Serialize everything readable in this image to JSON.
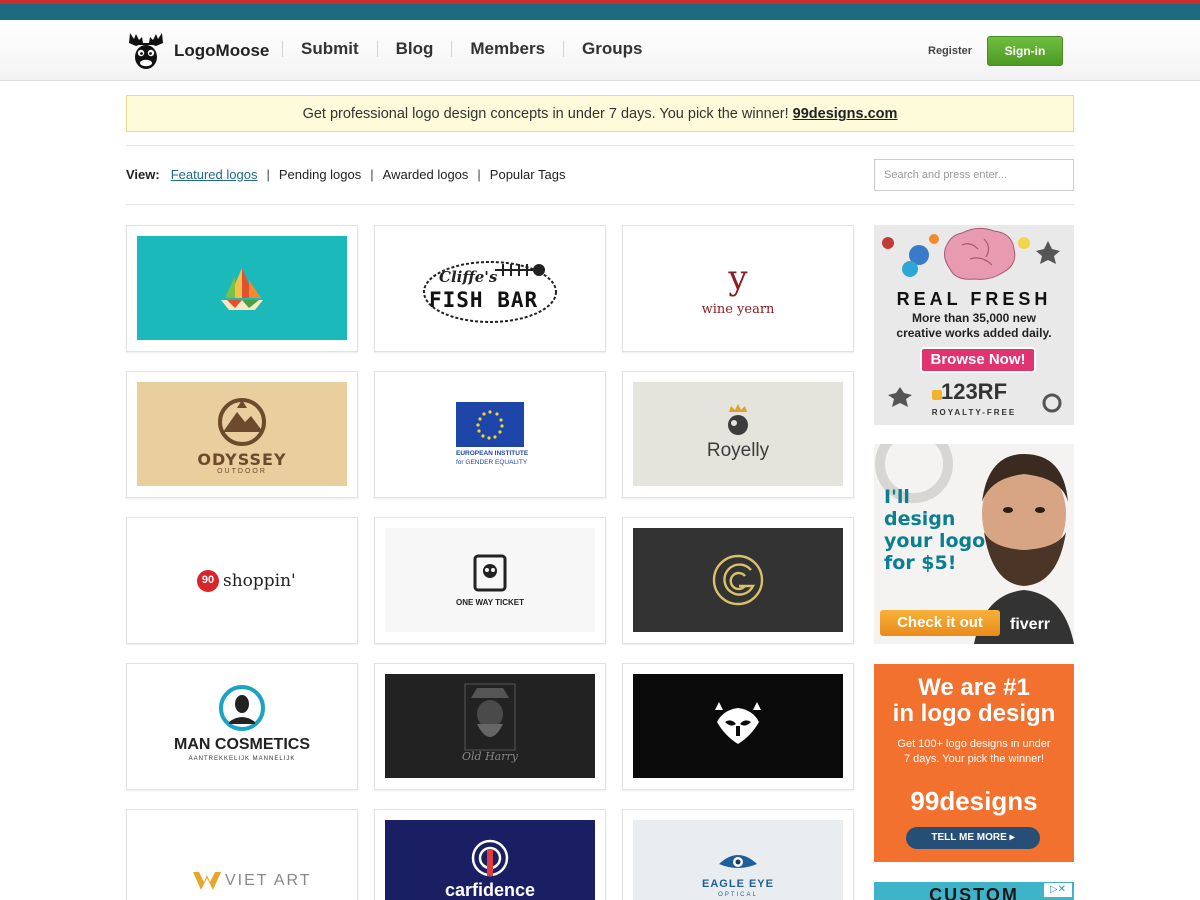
{
  "site": {
    "name": "LogoMoose"
  },
  "nav": {
    "items": [
      "Submit",
      "Blog",
      "Members",
      "Groups"
    ],
    "register": "Register",
    "signin": "Sign-in"
  },
  "promo": {
    "text": "Get professional logo design concepts in under 7 days. You pick the winner!",
    "link": "99designs.com"
  },
  "view": {
    "label": "View:",
    "links": [
      "Featured logos",
      "Pending logos",
      "Awarded logos",
      "Popular Tags"
    ],
    "active": 0
  },
  "search": {
    "placeholder": "Search and press enter..."
  },
  "logos": {
    "cliffes": {
      "line1": "Cliffe's",
      "line2": "FISH BAR"
    },
    "wine": {
      "mark": "y",
      "name": "wine yearn"
    },
    "odyssey": {
      "name": "ODYSSEY",
      "sub": "OUTDOOR"
    },
    "european": {
      "line1": "EUROPEAN INSTITUTE",
      "line2": "for GENDER EQUALITY"
    },
    "royelly": {
      "name": "Royelly"
    },
    "shoppin": {
      "badge": "90",
      "name": "shoppin'"
    },
    "oneway": {
      "name": "ONE WAY TICKET"
    },
    "man": {
      "name": "MAN COSMETICS",
      "sub": "AANTREKKELIJK MANNELIJK"
    },
    "oldharry": {
      "name": "Old Harry"
    },
    "vietart": {
      "name": "VIET ART"
    },
    "carfidence": {
      "name": "carfidence"
    },
    "eagle": {
      "name": "EAGLE EYE",
      "sub": "OPTICAL"
    }
  },
  "ads": {
    "rf": {
      "headline": "REAL FRESH",
      "sub1": "More than 35,000 new",
      "sub2": "creative works added daily.",
      "button": "Browse Now!",
      "brand": "123RF",
      "tag": "ROYALTY-FREE"
    },
    "fiverr": {
      "line1": "I'll",
      "line2": "design",
      "line3": "your logo",
      "line4": "for $5!",
      "button": "Check it out",
      "brand": "fiverr"
    },
    "nd": {
      "line1": "We are #1",
      "line2": "in logo design",
      "sub1": "Get 100+ logo designs in under",
      "sub2": "7 days. Your pick the winner!",
      "brand": "99designs",
      "button": "TELL ME MORE"
    },
    "custom": {
      "text": "CUSTOM"
    }
  },
  "colors": {
    "topbar": "#1d6a80",
    "accent": "#1f6a87",
    "signin": "#5aa82e",
    "promo_bg": "#fdfbd9"
  }
}
